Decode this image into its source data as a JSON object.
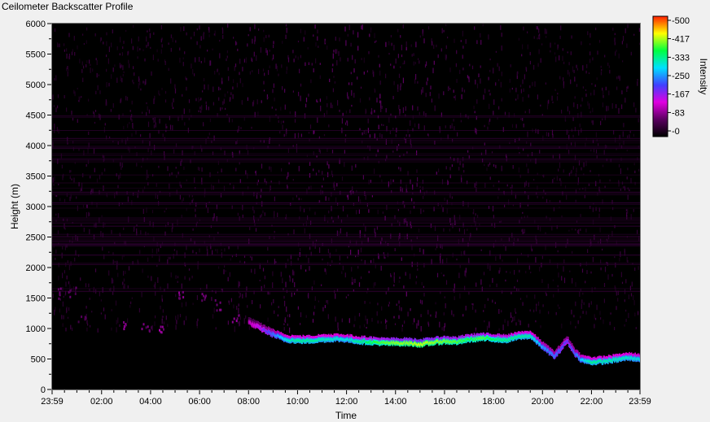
{
  "window": {
    "title": "Ceilometer Backscatter Profile"
  },
  "chart_data": {
    "type": "heatmap",
    "title": "Ceilometer Backscatter Profile",
    "xlabel": "Time",
    "ylabel": "Height (m)",
    "x_ticks": [
      "23:59",
      "02:00",
      "04:00",
      "06:00",
      "08:00",
      "10:00",
      "12:00",
      "14:00",
      "16:00",
      "18:00",
      "20:00",
      "22:00",
      "23:59"
    ],
    "x_tick_hours": [
      0,
      2.02,
      4.02,
      6.02,
      8.02,
      10.02,
      12.02,
      14.02,
      16.02,
      18.02,
      20.02,
      22.02,
      24
    ],
    "xlim_hours": [
      0,
      24
    ],
    "y_ticks": [
      0,
      500,
      1000,
      1500,
      2000,
      2500,
      3000,
      3500,
      4000,
      4500,
      5000,
      5500,
      6000
    ],
    "ylim": [
      0,
      6000
    ],
    "colorbar": {
      "label": "Intensity",
      "ticks": [
        0,
        83,
        167,
        250,
        333,
        417,
        500
      ],
      "tick_labels": [
        "0",
        "83",
        "167",
        "250",
        "333",
        "417",
        "500"
      ],
      "range": [
        0,
        500
      ],
      "colormap": [
        "#000000",
        "#5a0060",
        "#e000e0",
        "#4040ff",
        "#00e0ff",
        "#00ff40",
        "#ffff00",
        "#ff2000"
      ]
    },
    "background_color": "#000000",
    "layer": {
      "time_hours": [
        0.3,
        0.8,
        1.2,
        3.0,
        3.8,
        4.5,
        5.3,
        6.2,
        6.8,
        7.5,
        8.0,
        8.5,
        9.0,
        9.5,
        10.0,
        10.5,
        11.0,
        11.5,
        12.0,
        12.5,
        13.0,
        13.5,
        14.0,
        14.5,
        15.0,
        15.5,
        16.0,
        16.5,
        17.0,
        17.5,
        18.0,
        18.5,
        19.0,
        19.5,
        20.0,
        20.5,
        21.0,
        21.3,
        21.6,
        22.0,
        22.5,
        23.0,
        23.5,
        24.0
      ],
      "height_m": [
        1600,
        1620,
        1200,
        1050,
        1020,
        1030,
        1580,
        1500,
        1400,
        1150,
        1100,
        1000,
        900,
        820,
        800,
        800,
        820,
        830,
        820,
        790,
        780,
        760,
        760,
        760,
        740,
        770,
        790,
        780,
        820,
        840,
        830,
        810,
        860,
        880,
        700,
        540,
        800,
        600,
        480,
        450,
        460,
        490,
        520,
        500
      ],
      "intensity": [
        90,
        80,
        70,
        110,
        90,
        110,
        100,
        90,
        85,
        100,
        120,
        180,
        240,
        300,
        330,
        330,
        320,
        310,
        300,
        330,
        360,
        380,
        400,
        400,
        420,
        400,
        390,
        380,
        360,
        380,
        350,
        340,
        330,
        320,
        260,
        240,
        200,
        230,
        280,
        330,
        320,
        320,
        310,
        300
      ]
    }
  }
}
